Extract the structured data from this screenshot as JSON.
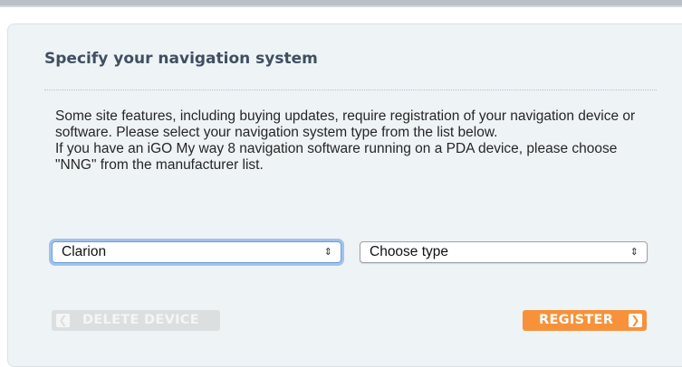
{
  "title": "Specify your navigation system",
  "description": {
    "paragraph1": "Some site features, including buying updates, require registration of your navigation device or software. Please select your navigation system type from the list below.",
    "paragraph2": "If you have an iGO My way 8 navigation software running on a PDA device, please choose \"NNG\" from the manufacturer list."
  },
  "manufacturer_select": {
    "selected": "Clarion"
  },
  "type_select": {
    "selected": "Choose type"
  },
  "buttons": {
    "delete_label": "DELETE DEVICE",
    "register_label": "REGISTER"
  },
  "icons": {
    "select_arrows": "up-down-arrows-icon",
    "delete_chevron": "chevron-left-icon",
    "register_chevron": "chevron-right-icon"
  },
  "colors": {
    "register_accent": "#f7923a",
    "delete_disabled": "#dcdfe0",
    "title_color": "#3f4f61",
    "panel_background": "#eef3f6"
  }
}
